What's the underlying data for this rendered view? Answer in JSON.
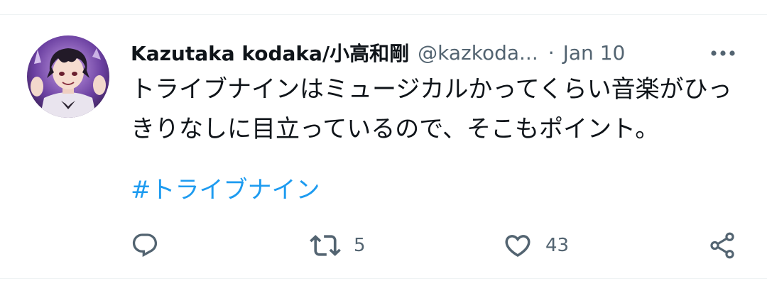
{
  "tweet": {
    "display_name": "Kazutaka kodaka/小高和剛",
    "handle": "@kazkoda...",
    "separator": "·",
    "date": "Jan 10",
    "text": "トライブナインはミュージカルかってくらい音楽がひっきりなしに目立っているので、そこもポイント。",
    "hashtag": "#トライブナイン"
  },
  "actions": {
    "reply_count": "",
    "retweet_count": "5",
    "like_count": "43"
  },
  "icons": {
    "more": "more-horizontal-icon",
    "reply": "reply-icon",
    "retweet": "retweet-icon",
    "like": "heart-icon",
    "share": "share-icon"
  },
  "colors": {
    "text": "#0f1419",
    "secondary": "#536471",
    "link": "#1d9bf0",
    "divider": "#eff3f4"
  }
}
